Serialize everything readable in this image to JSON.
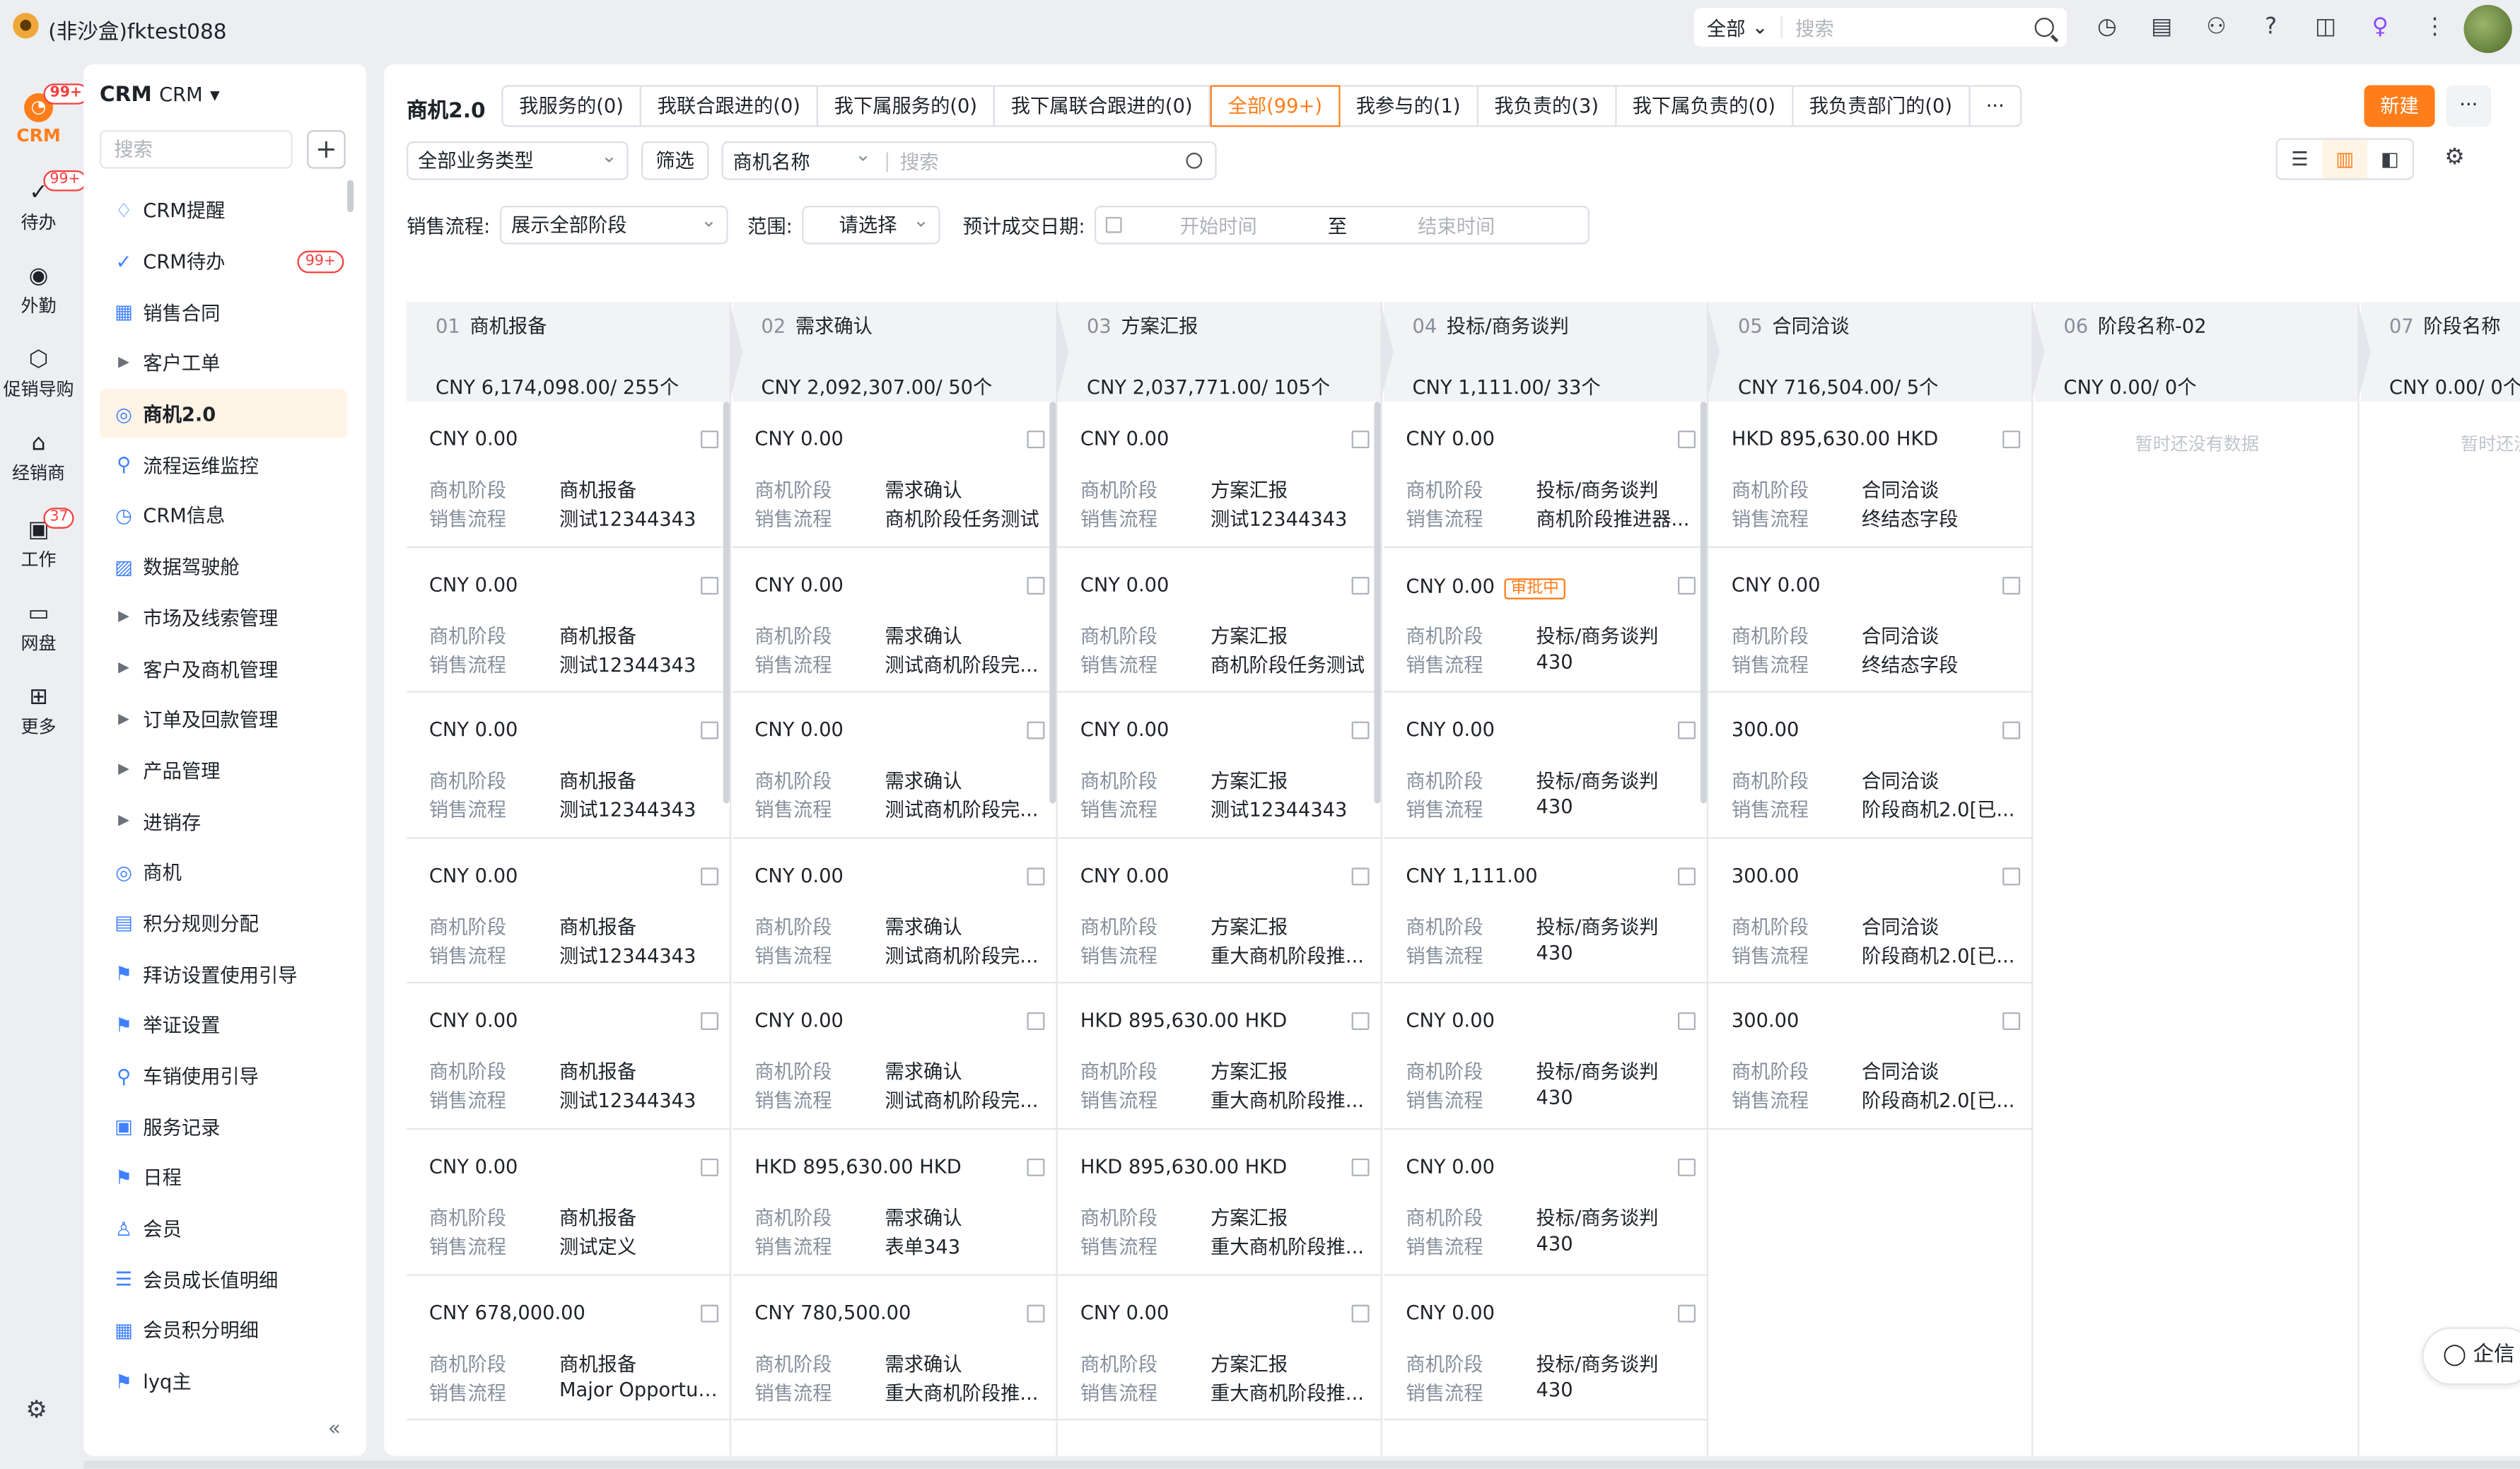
{
  "app": {
    "title": "(非沙盒)fktest088",
    "search_scope": "全部",
    "search_placeholder": "搜索"
  },
  "rail": [
    {
      "name": "CRM",
      "badge": "99+",
      "active": true,
      "icon": "crm-icon"
    },
    {
      "name": "待办",
      "badge": "99+",
      "icon": "check-circle-icon"
    },
    {
      "name": "外勤",
      "icon": "location-icon"
    },
    {
      "name": "促销导购",
      "icon": "cube-icon"
    },
    {
      "name": "经销商",
      "icon": "store-icon"
    },
    {
      "name": "工作",
      "badge": "37",
      "icon": "briefcase-icon"
    },
    {
      "name": "网盘",
      "icon": "disk-icon"
    },
    {
      "name": "更多",
      "icon": "grid-icon"
    }
  ],
  "sidebar": {
    "title": "CRM",
    "subtitle": "CRM",
    "search_placeholder": "搜索",
    "items": [
      {
        "label": "CRM提醒",
        "icon": "bell-icon"
      },
      {
        "label": "CRM待办",
        "icon": "check-icon",
        "badge": "99+"
      },
      {
        "label": "销售合同",
        "icon": "contract-icon"
      },
      {
        "label": "客户工单",
        "caret": true
      },
      {
        "label": "商机2.0",
        "icon": "target-icon",
        "active": true
      },
      {
        "label": "流程运维监控",
        "icon": "flow-icon"
      },
      {
        "label": "CRM信息",
        "icon": "clock-icon"
      },
      {
        "label": "数据驾驶舱",
        "icon": "chart-icon"
      },
      {
        "label": "市场及线索管理",
        "caret": true
      },
      {
        "label": "客户及商机管理",
        "caret": true
      },
      {
        "label": "订单及回款管理",
        "caret": true
      },
      {
        "label": "产品管理",
        "caret": true
      },
      {
        "label": "进销存",
        "caret": true
      },
      {
        "label": "商机",
        "icon": "target-icon"
      },
      {
        "label": "积分规则分配",
        "icon": "doc-icon"
      },
      {
        "label": "拜访设置使用引导",
        "icon": "flag-icon"
      },
      {
        "label": "举证设置",
        "icon": "flag-icon"
      },
      {
        "label": "车销使用引导",
        "icon": "flow-icon"
      },
      {
        "label": "服务记录",
        "icon": "record-icon"
      },
      {
        "label": "日程",
        "icon": "flag-icon"
      },
      {
        "label": "会员",
        "icon": "user-icon"
      },
      {
        "label": "会员成长值明细",
        "icon": "list-icon"
      },
      {
        "label": "会员积分明细",
        "icon": "table-icon"
      },
      {
        "label": "lyq主",
        "icon": "flag-icon"
      }
    ]
  },
  "main": {
    "title": "商机2.0",
    "tabs": [
      "我服务的(0)",
      "我联合跟进的(0)",
      "我下属服务的(0)",
      "我下属联合跟进的(0)",
      "全部(99+)",
      "我参与的(1)",
      "我负责的(3)",
      "我下属负责的(0)",
      "我负责部门的(0)",
      "···"
    ],
    "active_tab": 4,
    "new_label": "新建",
    "more_label": "···",
    "filter": {
      "biz_type": "全部业务类型",
      "filter_btn": "筛选",
      "field": "商机名称",
      "search_placeholder": "搜索",
      "sales_process_label": "销售流程:",
      "sales_process_value": "展示全部阶段",
      "scope_label": "范围:",
      "scope_value": "请选择",
      "date_label": "预计成交日期:",
      "date_start": "开始时间",
      "date_sep": "至",
      "date_end": "结束时间"
    }
  },
  "labels": {
    "stage": "商机阶段",
    "process": "销售流程",
    "empty": "暂时还没有数据",
    "approving": "审批中"
  },
  "columns": [
    {
      "num": "01",
      "name": "商机报备",
      "sum": "CNY 6,174,098.00/ 255个",
      "cards": [
        {
          "amt": "CNY 0.00",
          "stage": "商机报备",
          "proc": "测试12344343"
        },
        {
          "amt": "CNY 0.00",
          "stage": "商机报备",
          "proc": "测试12344343"
        },
        {
          "amt": "CNY 0.00",
          "stage": "商机报备",
          "proc": "测试12344343"
        },
        {
          "amt": "CNY 0.00",
          "stage": "商机报备",
          "proc": "测试12344343"
        },
        {
          "amt": "CNY 0.00",
          "stage": "商机报备",
          "proc": "测试12344343"
        },
        {
          "amt": "CNY 0.00",
          "stage": "商机报备",
          "proc": "测试定义"
        },
        {
          "amt": "CNY 678,000.00",
          "stage": "商机报备",
          "proc": "Major Opportun..."
        }
      ]
    },
    {
      "num": "02",
      "name": "需求确认",
      "sum": "CNY 2,092,307.00/ 50个",
      "cards": [
        {
          "amt": "CNY 0.00",
          "stage": "需求确认",
          "proc": "商机阶段任务测试"
        },
        {
          "amt": "CNY 0.00",
          "stage": "需求确认",
          "proc": "测试商机阶段完..."
        },
        {
          "amt": "CNY 0.00",
          "stage": "需求确认",
          "proc": "测试商机阶段完..."
        },
        {
          "amt": "CNY 0.00",
          "stage": "需求确认",
          "proc": "测试商机阶段完..."
        },
        {
          "amt": "CNY 0.00",
          "stage": "需求确认",
          "proc": "测试商机阶段完..."
        },
        {
          "amt": "HKD 895,630.00 HKD",
          "stage": "需求确认",
          "proc": "表单343"
        },
        {
          "amt": "CNY 780,500.00",
          "stage": "需求确认",
          "proc": "重大商机阶段推..."
        }
      ]
    },
    {
      "num": "03",
      "name": "方案汇报",
      "sum": "CNY 2,037,771.00/ 105个",
      "cards": [
        {
          "amt": "CNY 0.00",
          "stage": "方案汇报",
          "proc": "测试12344343"
        },
        {
          "amt": "CNY 0.00",
          "stage": "方案汇报",
          "proc": "商机阶段任务测试"
        },
        {
          "amt": "CNY 0.00",
          "stage": "方案汇报",
          "proc": "测试12344343"
        },
        {
          "amt": "CNY 0.00",
          "stage": "方案汇报",
          "proc": "重大商机阶段推..."
        },
        {
          "amt": "HKD 895,630.00 HKD",
          "stage": "方案汇报",
          "proc": "重大商机阶段推..."
        },
        {
          "amt": "HKD 895,630.00 HKD",
          "stage": "方案汇报",
          "proc": "重大商机阶段推..."
        },
        {
          "amt": "CNY 0.00",
          "stage": "方案汇报",
          "proc": "重大商机阶段推..."
        }
      ]
    },
    {
      "num": "04",
      "name": "投标/商务谈判",
      "sum": "CNY 1,111.00/ 33个",
      "cards": [
        {
          "amt": "CNY 0.00",
          "stage": "投标/商务谈判",
          "proc": "商机阶段推进器..."
        },
        {
          "amt": "CNY 0.00",
          "stage": "投标/商务谈判",
          "proc": "430",
          "tag": true
        },
        {
          "amt": "CNY 0.00",
          "stage": "投标/商务谈判",
          "proc": "430"
        },
        {
          "amt": "CNY 1,111.00",
          "stage": "投标/商务谈判",
          "proc": "430"
        },
        {
          "amt": "CNY 0.00",
          "stage": "投标/商务谈判",
          "proc": "430"
        },
        {
          "amt": "CNY 0.00",
          "stage": "投标/商务谈判",
          "proc": "430"
        },
        {
          "amt": "CNY 0.00",
          "stage": "投标/商务谈判",
          "proc": "430"
        }
      ]
    },
    {
      "num": "05",
      "name": "合同洽谈",
      "sum": "CNY 716,504.00/ 5个",
      "cards": [
        {
          "amt": "HKD 895,630.00 HKD",
          "stage": "合同洽谈",
          "proc": "终结态字段"
        },
        {
          "amt": "CNY 0.00",
          "stage": "合同洽谈",
          "proc": "终结态字段"
        },
        {
          "amt": "300.00",
          "stage": "合同洽谈",
          "proc": "阶段商机2.0[已..."
        },
        {
          "amt": "300.00",
          "stage": "合同洽谈",
          "proc": "阶段商机2.0[已..."
        },
        {
          "amt": "300.00",
          "stage": "合同洽谈",
          "proc": "阶段商机2.0[已..."
        }
      ]
    },
    {
      "num": "06",
      "name": "阶段名称-02",
      "sum": "CNY 0.00/ 0个",
      "cards": [],
      "empty": true
    },
    {
      "num": "07",
      "name": "阶段名称",
      "sum": "CNY 0.00/ 0个",
      "cards": [],
      "empty": true
    }
  ],
  "chat_label": "企信"
}
